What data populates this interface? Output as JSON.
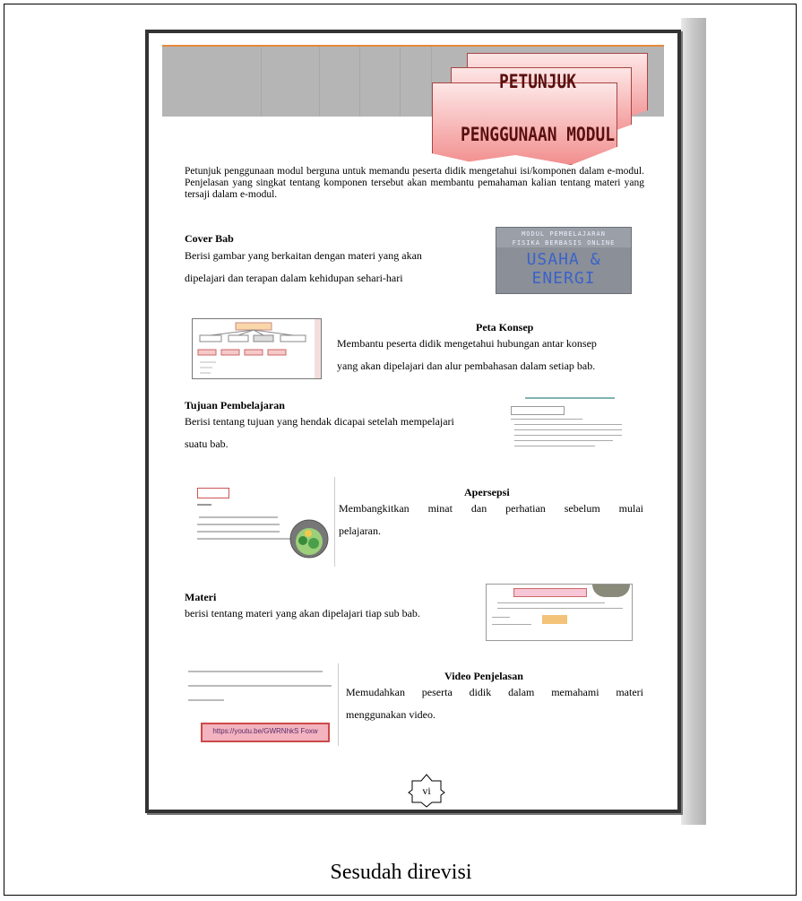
{
  "page_title": {
    "line1": "PETUNJUK",
    "line2": "PENGGUNAAN MODUL"
  },
  "intro": "Petunjuk penggunaan modul berguna untuk memandu peserta didik mengetahui isi/komponen dalam e-modul. Penjelasan yang singkat tentang komponen tersebut akan membantu pemahaman kalian tentang materi yang tersaji dalam e-modul.",
  "sections": {
    "cover": {
      "title": "Cover Bab",
      "text_line1": "Berisi gambar yang berkaitan dengan materi yang akan",
      "text_line2": "dipelajari dan terapan dalam kehidupan sehari-hari",
      "thumb_top": "MODUL PEMBELAJARAN",
      "thumb_sub": "FISIKA BERBASIS ONLINE",
      "thumb_big": "USAHA & ENERGI"
    },
    "peta": {
      "title": "Peta Konsep",
      "text_line1": "Membantu peserta didik mengetahui hubungan antar konsep",
      "text_line2": "yang akan dipelajari dan alur pembahasan dalam setiap bab."
    },
    "tujuan": {
      "title": "Tujuan Pembelajaran",
      "text_line1": "Berisi tentang tujuan yang hendak dicapai setelah mempelajari",
      "text_line2": "suatu bab."
    },
    "apersepsi": {
      "title": "Apersepsi",
      "text_line1": "Membangkitkan minat dan perhatian sebelum mulai",
      "text_line2": "pelajaran."
    },
    "materi": {
      "title": "Materi",
      "text": "berisi tentang materi yang akan dipelajari tiap sub bab."
    },
    "video": {
      "title": "Video Penjelasan",
      "text_line1": "Memudahkan peserta didik dalam memahami materi",
      "text_line2": "menggunakan video.",
      "thumb_button": "https://youtu.be/GWRNhkS Foxw"
    }
  },
  "page_number": "vi",
  "caption": "Sesudah direvisi",
  "colors": {
    "ribbon_light": "#fde6e6",
    "ribbon_dark": "#f28f8f",
    "header_band": "#b5b5b5",
    "cover_text": "#3b62c9"
  }
}
